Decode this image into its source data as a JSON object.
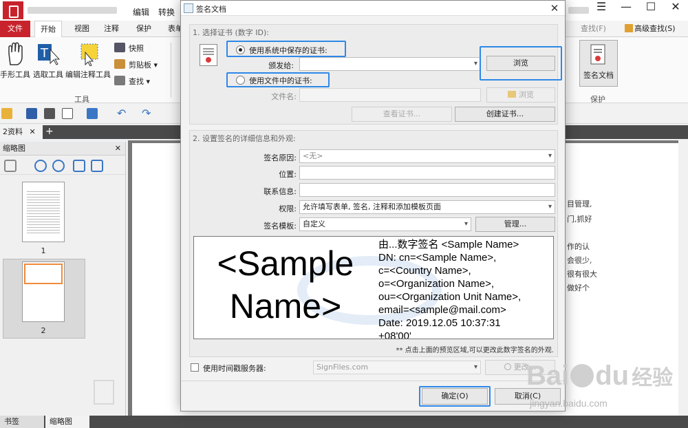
{
  "app": {
    "menu_items": [
      "编辑",
      "转换"
    ],
    "window_controls": [
      "hamburger-icon",
      "minimize-icon",
      "maximize-icon",
      "close-icon"
    ],
    "ribbon_tabs": [
      "文件",
      "开始",
      "视图",
      "注释",
      "保护",
      "表单"
    ],
    "ribbon_right": {
      "find": "查找(F)",
      "advanced_find": "高级查找(S)"
    },
    "tools": {
      "hand": "手形工具",
      "select": "选取工具",
      "edit_annot": "编辑注释工具",
      "snapshot": "快照",
      "clipboard": "剪贴板",
      "find": "查找",
      "group_label": "工具"
    },
    "sign_doc_btn": "签名文档",
    "protect_label": "保护",
    "doc_tab": "2资料",
    "left_panel": {
      "title": "缩略图",
      "page1": "1",
      "page2": "2"
    },
    "bottom_tabs": [
      "书签",
      "缩略图"
    ],
    "doc_fragments": [
      "目管理,",
      "门,抓好",
      "作的认",
      "会很少,",
      "很有很大",
      "做好个"
    ],
    "accent_red": "#c8232c",
    "highlight_blue": "#2e88e8"
  },
  "dialog": {
    "title": "签名文档",
    "section1": {
      "title": "1. 选择证书 (数字 ID):",
      "radio_system": "使用系统中保存的证书:",
      "issued_to_label": "颁发给:",
      "issued_to_value": "",
      "browse": "浏览",
      "radio_file": "使用文件中的证书:",
      "filename_label": "文件名:",
      "filename_value": "",
      "browse2": "浏览",
      "view_cert": "查看证书...",
      "create_cert": "创建证书..."
    },
    "section2": {
      "title": "2. 设置签名的详细信息和外观:",
      "reason_label": "签名原因:",
      "reason_value": "<无>",
      "location_label": "位置:",
      "location_value": "",
      "contact_label": "联系信息:",
      "contact_value": "",
      "permission_label": "权限:",
      "permission_value": "允许填写表单, 签名, 注释和添加模板页面",
      "template_label": "签名模板:",
      "template_value": "自定义",
      "manage": "管理...",
      "preview_name": "<Sample Name>",
      "preview_details": "由...数字签名 <Sample Name>\nDN: cn=<Sample Name>,\nc=<Country Name>,\no=<Organization Name>,\nou=<Organization Unit Name>,\nemail=<sample@mail.com>\nDate: 2019.12.05 10:37:31\n+08'00'",
      "hint": "** 点击上面的预览区域,可以更改此数字签名的外观."
    },
    "timestamp": {
      "label": "使用时间戳服务器:",
      "server": "SignFiles.com",
      "change": "更改..."
    },
    "ok": "确定(O)",
    "cancel": "取消(C)"
  },
  "watermark": {
    "logo_left": "Bai",
    "logo_right": "du",
    "logo_cn": "经验",
    "url": "jingyan.baidu.com"
  }
}
